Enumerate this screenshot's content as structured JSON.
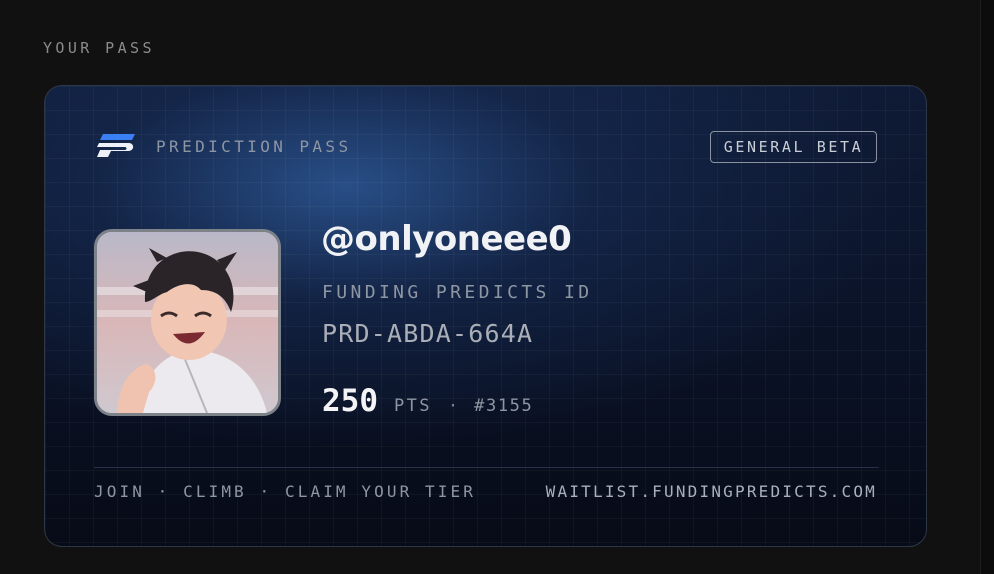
{
  "section": {
    "title": "YOUR PASS"
  },
  "pass": {
    "brand_label": "PREDICTION PASS",
    "badge": "GENERAL BETA",
    "logo_icon": "funding-predicts-logo-icon",
    "avatar": "anime-character-avatar",
    "handle": "@onlyoneee0",
    "id_label": "FUNDING PREDICTS ID",
    "id_value": "PRD-ABDA-664A",
    "points": "250",
    "points_unit": "PTS",
    "separator": "·",
    "rank": "#3155",
    "footer_left": "JOIN · CLIMB · CLAIM YOUR TIER",
    "footer_right": "WAITLIST.FUNDINGPREDICTS.COM"
  },
  "colors": {
    "page_background": "#111111",
    "card_background": "#0b1429",
    "card_glow": "#2d5896",
    "logo_accent": "#3b7ff5",
    "text_primary": "#f1f2f5",
    "text_muted": "#8e96a4"
  }
}
